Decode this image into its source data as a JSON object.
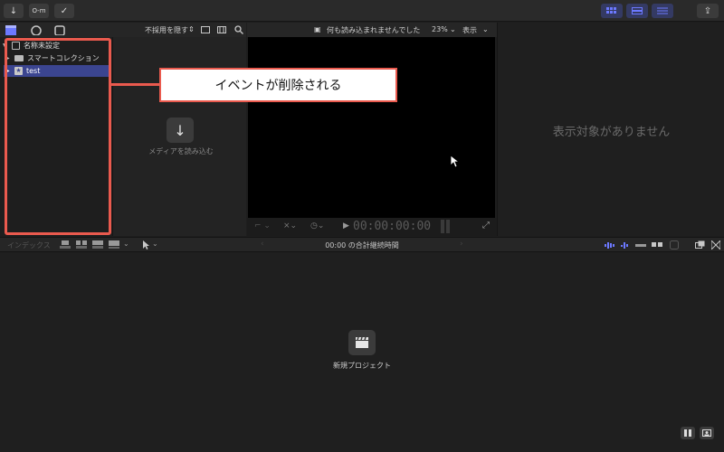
{
  "toolbar": {
    "import_icon": "↓",
    "keyword_icon": "O-m",
    "analyze_icon": "✓",
    "share_icon": "⇪"
  },
  "library": {
    "hide_rejected_label": "不採用を隠す",
    "items": [
      {
        "label": "名称未設定"
      },
      {
        "label": "スマートコレクション"
      },
      {
        "label": "test"
      }
    ]
  },
  "browser": {
    "import_label": "メディアを読み込む"
  },
  "viewer": {
    "status": "何も読み込まれませんでした",
    "zoom": "23%",
    "view_label": "表示",
    "timecode": "00:00:00:00"
  },
  "inspector": {
    "empty_text": "表示対象がありません"
  },
  "timeline": {
    "index_label": "インデックス",
    "duration_text": "00:00 の合計継続時間",
    "new_project_label": "新規プロジェクト"
  },
  "annotation": {
    "callout_text": "イベントが削除される",
    "color": "#ea5a4e"
  }
}
